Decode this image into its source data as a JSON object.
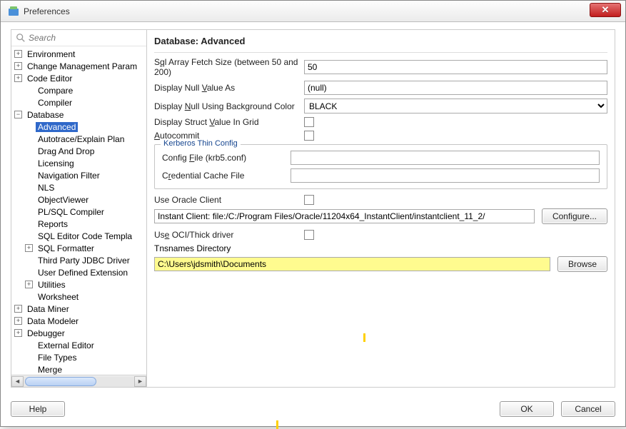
{
  "window": {
    "title": "Preferences"
  },
  "search": {
    "placeholder": "Search"
  },
  "tree": {
    "items": [
      {
        "label": "Environment",
        "twisty": "+",
        "depth": 0
      },
      {
        "label": "Change Management Param",
        "twisty": "+",
        "depth": 0
      },
      {
        "label": "Code Editor",
        "twisty": "+",
        "depth": 0
      },
      {
        "label": "Compare",
        "twisty": "",
        "depth": 1
      },
      {
        "label": "Compiler",
        "twisty": "",
        "depth": 1
      },
      {
        "label": "Database",
        "twisty": "−",
        "depth": 0
      },
      {
        "label": "Advanced",
        "twisty": "",
        "depth": 1,
        "selected": true
      },
      {
        "label": "Autotrace/Explain Plan",
        "twisty": "",
        "depth": 1
      },
      {
        "label": "Drag And Drop",
        "twisty": "",
        "depth": 1
      },
      {
        "label": "Licensing",
        "twisty": "",
        "depth": 1
      },
      {
        "label": "Navigation Filter",
        "twisty": "",
        "depth": 1
      },
      {
        "label": "NLS",
        "twisty": "",
        "depth": 1
      },
      {
        "label": "ObjectViewer",
        "twisty": "",
        "depth": 1
      },
      {
        "label": "PL/SQL Compiler",
        "twisty": "",
        "depth": 1
      },
      {
        "label": "Reports",
        "twisty": "",
        "depth": 1
      },
      {
        "label": "SQL Editor Code Templa",
        "twisty": "",
        "depth": 1
      },
      {
        "label": "SQL Formatter",
        "twisty": "+",
        "depth": 1
      },
      {
        "label": "Third Party JDBC Driver",
        "twisty": "",
        "depth": 1
      },
      {
        "label": "User Defined Extension",
        "twisty": "",
        "depth": 1
      },
      {
        "label": "Utilities",
        "twisty": "+",
        "depth": 1
      },
      {
        "label": "Worksheet",
        "twisty": "",
        "depth": 1
      },
      {
        "label": "Data Miner",
        "twisty": "+",
        "depth": 0
      },
      {
        "label": "Data Modeler",
        "twisty": "+",
        "depth": 0
      },
      {
        "label": "Debugger",
        "twisty": "+",
        "depth": 0
      },
      {
        "label": "External Editor",
        "twisty": "",
        "depth": 1
      },
      {
        "label": "File Types",
        "twisty": "",
        "depth": 1
      },
      {
        "label": "Merge",
        "twisty": "",
        "depth": 1
      }
    ]
  },
  "page": {
    "heading": "Database: Advanced",
    "fetch_label_pre": "S",
    "fetch_label_ul": "q",
    "fetch_label_post": "l Array Fetch Size (between 50 and 200)",
    "fetch_value": "50",
    "null_label": "Display Null Value As",
    "null_label_ul": "V",
    "null_value": "(null)",
    "null_bg_label_pre": "Display ",
    "null_bg_label_ul": "N",
    "null_bg_label_post": "ull Using Background Color",
    "null_bg_value": "BLACK",
    "struct_label_pre": "Display Struct ",
    "struct_label_ul": "V",
    "struct_label_post": "alue In Grid",
    "autocommit_label_ul": "A",
    "autocommit_label_post": "utocommit",
    "kerberos_legend": "Kerberos Thin Config",
    "k_config_label_pre": "Config ",
    "k_config_label_ul": "F",
    "k_config_label_post": "ile (krb5.conf)",
    "k_cred_label_pre": "C",
    "k_cred_label_ul": "r",
    "k_cred_label_post": "edential Cache File",
    "use_oracle_label": "Use Oracle Client",
    "instant_client_value": "Instant Client: file:/C:/Program Files/Oracle/11204x64_InstantClient/instantclient_11_2/",
    "configure_btn": "Configure...",
    "use_oci_label_pre": "Us",
    "use_oci_label_ul": "e",
    "use_oci_label_post": " OCI/Thick driver",
    "tns_label_ul": "T",
    "tns_label_post": "nsnames Directory",
    "tns_value": "C:\\Users\\jdsmith\\Documents",
    "browse_btn": "Browse"
  },
  "buttons": {
    "help": "Help",
    "ok": "OK",
    "cancel": "Cancel"
  }
}
